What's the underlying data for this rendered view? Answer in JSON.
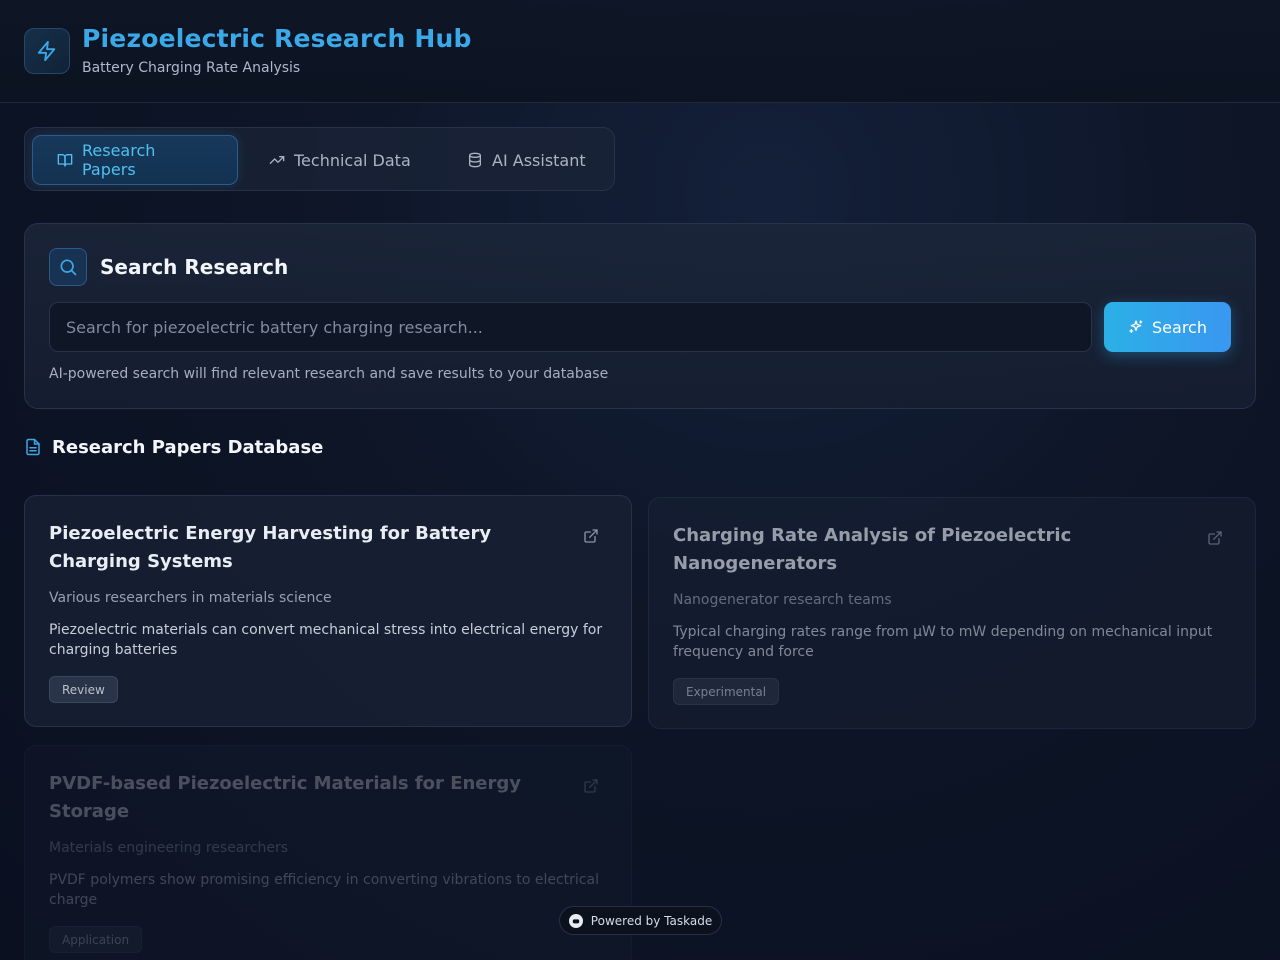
{
  "header": {
    "title": "Piezoelectric Research Hub",
    "subtitle": "Battery Charging Rate Analysis",
    "logo_icon": "lightning-bolt-icon"
  },
  "tabs": [
    {
      "label": "Research Papers",
      "icon": "book-open-icon",
      "active": true
    },
    {
      "label": "Technical Data",
      "icon": "trending-up-icon",
      "active": false
    },
    {
      "label": "AI Assistant",
      "icon": "database-icon",
      "active": false
    }
  ],
  "search": {
    "heading": "Search Research",
    "placeholder": "Search for piezoelectric battery charging research...",
    "value": "",
    "button_label": "Search",
    "hint": "AI-powered search will find relevant research and save results to your database"
  },
  "database": {
    "heading": "Research Papers Database",
    "papers": [
      {
        "title": "Piezoelectric Energy Harvesting for Battery Charging Systems",
        "authors": "Various researchers in materials science",
        "summary": "Piezoelectric materials can convert mechanical stress into electrical energy for charging batteries",
        "tag": "Review"
      },
      {
        "title": "Charging Rate Analysis of Piezoelectric Nanogenerators",
        "authors": "Nanogenerator research teams",
        "summary": "Typical charging rates range from μW to mW depending on mechanical input frequency and force",
        "tag": "Experimental"
      },
      {
        "title": "PVDF-based Piezoelectric Materials for Energy Storage",
        "authors": "Materials engineering researchers",
        "summary": "PVDF polymers show promising efficiency in converting vibrations to electrical charge",
        "tag": "Application"
      }
    ]
  },
  "footer": {
    "powered_by": "Powered by Taskade"
  },
  "colors": {
    "accent": "#3ba8e8",
    "button_start": "#2bb0e6",
    "button_end": "#3a97f0",
    "background": "#0d1526"
  }
}
